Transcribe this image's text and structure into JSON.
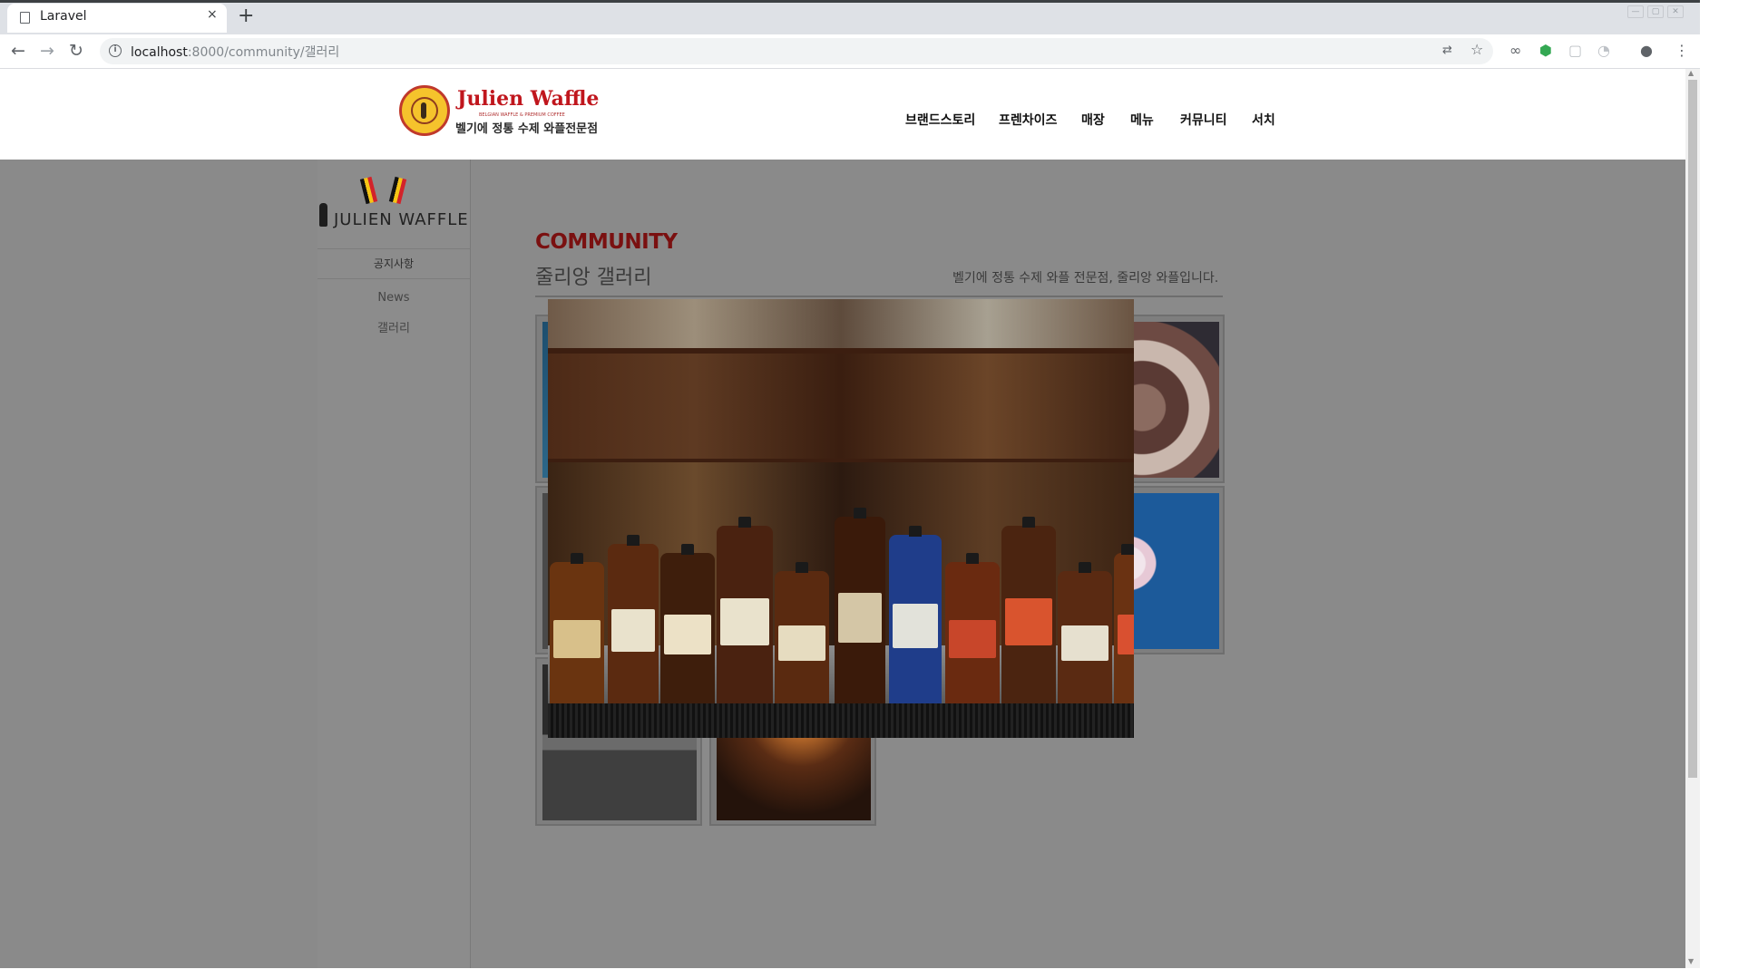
{
  "browser": {
    "tab_title": "Laravel",
    "tab_close": "×",
    "new_tab": "+",
    "url_host": "localhost",
    "url_path": ":8000/community/갤러리"
  },
  "header": {
    "brand_name": "Julien Waffle",
    "brand_small": "BELGIAN WAFFLE & PREMIUM COFFEE",
    "brand_kr": "벨기에 정통 수제 와플전문점",
    "nav": [
      "브랜드스토리",
      "프렌차이즈",
      "매장",
      "메뉴",
      "커뮤니티",
      "서치"
    ]
  },
  "sidebar": {
    "brand": "JULIEN WAFFLE",
    "title": "공지사항",
    "items": [
      "News",
      "갤러리"
    ]
  },
  "content": {
    "title": "COMMUNITY",
    "subtitle": "줄리앙 갤러리",
    "description": "벨기에 정통 수제 와플 전문점, 줄리앙 와플입니다."
  },
  "colors": {
    "brand_red": "#c0161d",
    "community_red": "#7a1010",
    "overlay_grey": "#8a8a8a"
  }
}
